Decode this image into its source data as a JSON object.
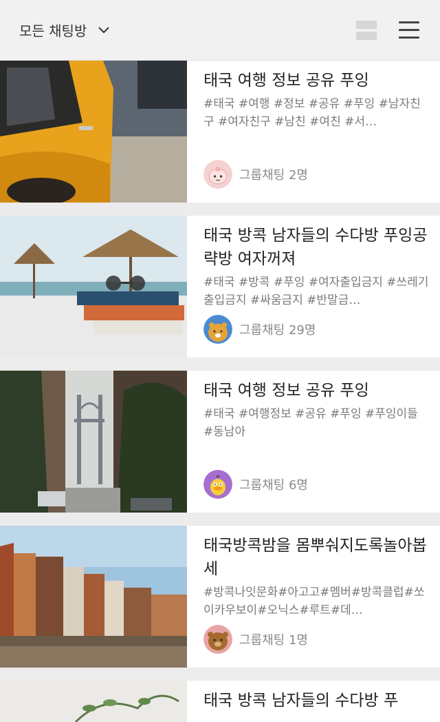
{
  "header": {
    "filter_label": "모든 채팅방",
    "icons": [
      "chevron-down-icon",
      "grid-view-icon",
      "menu-icon"
    ]
  },
  "rooms": [
    {
      "title": "태국 여행 정보 공유 푸잉",
      "tags": "#태국 #여행 #정보 #공유 #푸잉 #남자친구 #여자친구 #남친 #여친 #서…",
      "type_count": "그룹채팅 2명",
      "thumbnail": "yellow-taxi-street-photo",
      "avatar": "peach-character"
    },
    {
      "title": "태국 방콕 남자들의 수다방 푸잉공략방 여자꺼져",
      "tags": "#태국 #방콕 #푸잉 #여자출입금지 #쓰레기출입금지 #싸움금지 #반말금…",
      "type_count": "그룹채팅 29명",
      "thumbnail": "beach-books-sunglasses-photo",
      "avatar": "lion-character"
    },
    {
      "title": "태국 여행 정보 공유 푸잉",
      "tags": "#태국 #여행정보 #공유 #푸잉 #푸잉이들 #동남아",
      "type_count": "그룹채팅 6명",
      "thumbnail": "manhattan-bridge-street-photo",
      "avatar": "duck-character"
    },
    {
      "title": "태국방콕밤을 몸뿌숴지도록놀아봅세",
      "tags": "#방콕나잇문화#아고고#멤버#방콕클럽#쏘이카우보이#오닉스#루트#데…",
      "type_count": "그룹채팅 1명",
      "thumbnail": "canal-houses-photo",
      "avatar": "bear-character"
    },
    {
      "title": "태국 방콕 남자들의 수다방 푸",
      "thumbnail": "plant-leaves-photo"
    }
  ]
}
